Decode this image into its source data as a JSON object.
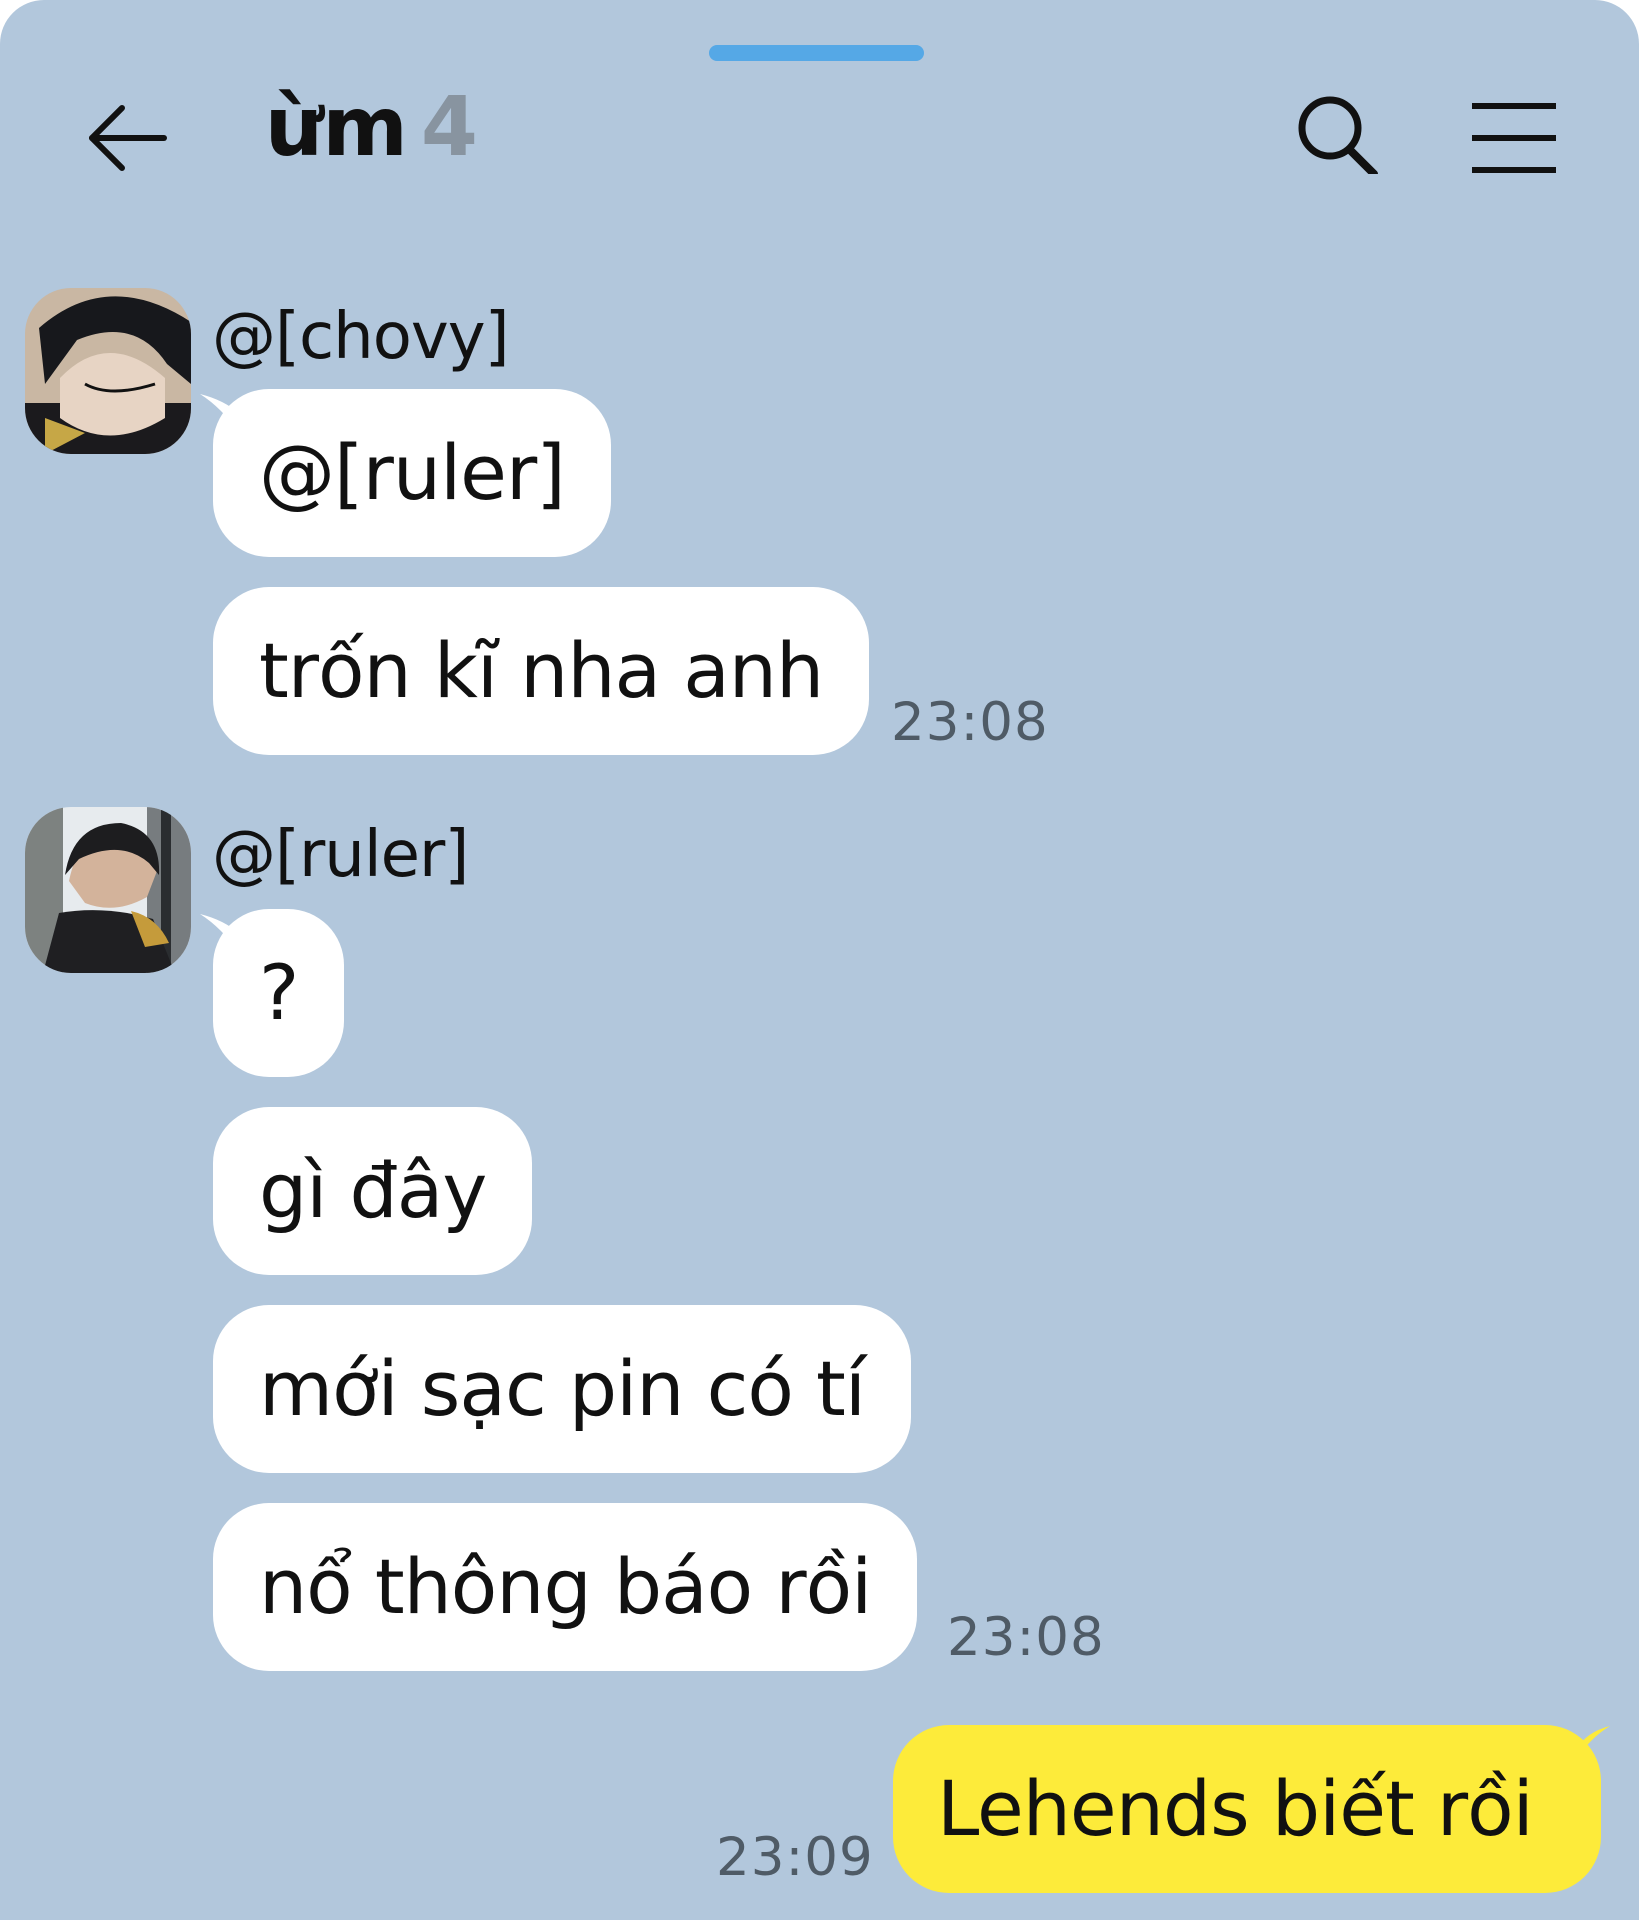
{
  "header": {
    "title": "ừm",
    "member_count": "4",
    "back_icon": "arrow-left-icon",
    "search_icon": "search-icon",
    "menu_icon": "menu-icon"
  },
  "messages": [
    {
      "sender": "@[chovy]",
      "bubbles": [
        "@[ruler]",
        "trốn kĩ nha anh"
      ],
      "time": "23:08"
    },
    {
      "sender": "@[ruler]",
      "bubbles": [
        "?",
        "gì đây",
        "mới sạc pin có tí",
        "nổ thông báo rồi"
      ],
      "time": "23:08"
    }
  ],
  "my_message": {
    "text": "Lehends biết rồi",
    "time": "23:09"
  },
  "colors": {
    "background": "#b2c7dc",
    "incoming_bubble": "#ffffff",
    "outgoing_bubble": "#fdeb3a",
    "handle": "#55a8e6"
  }
}
